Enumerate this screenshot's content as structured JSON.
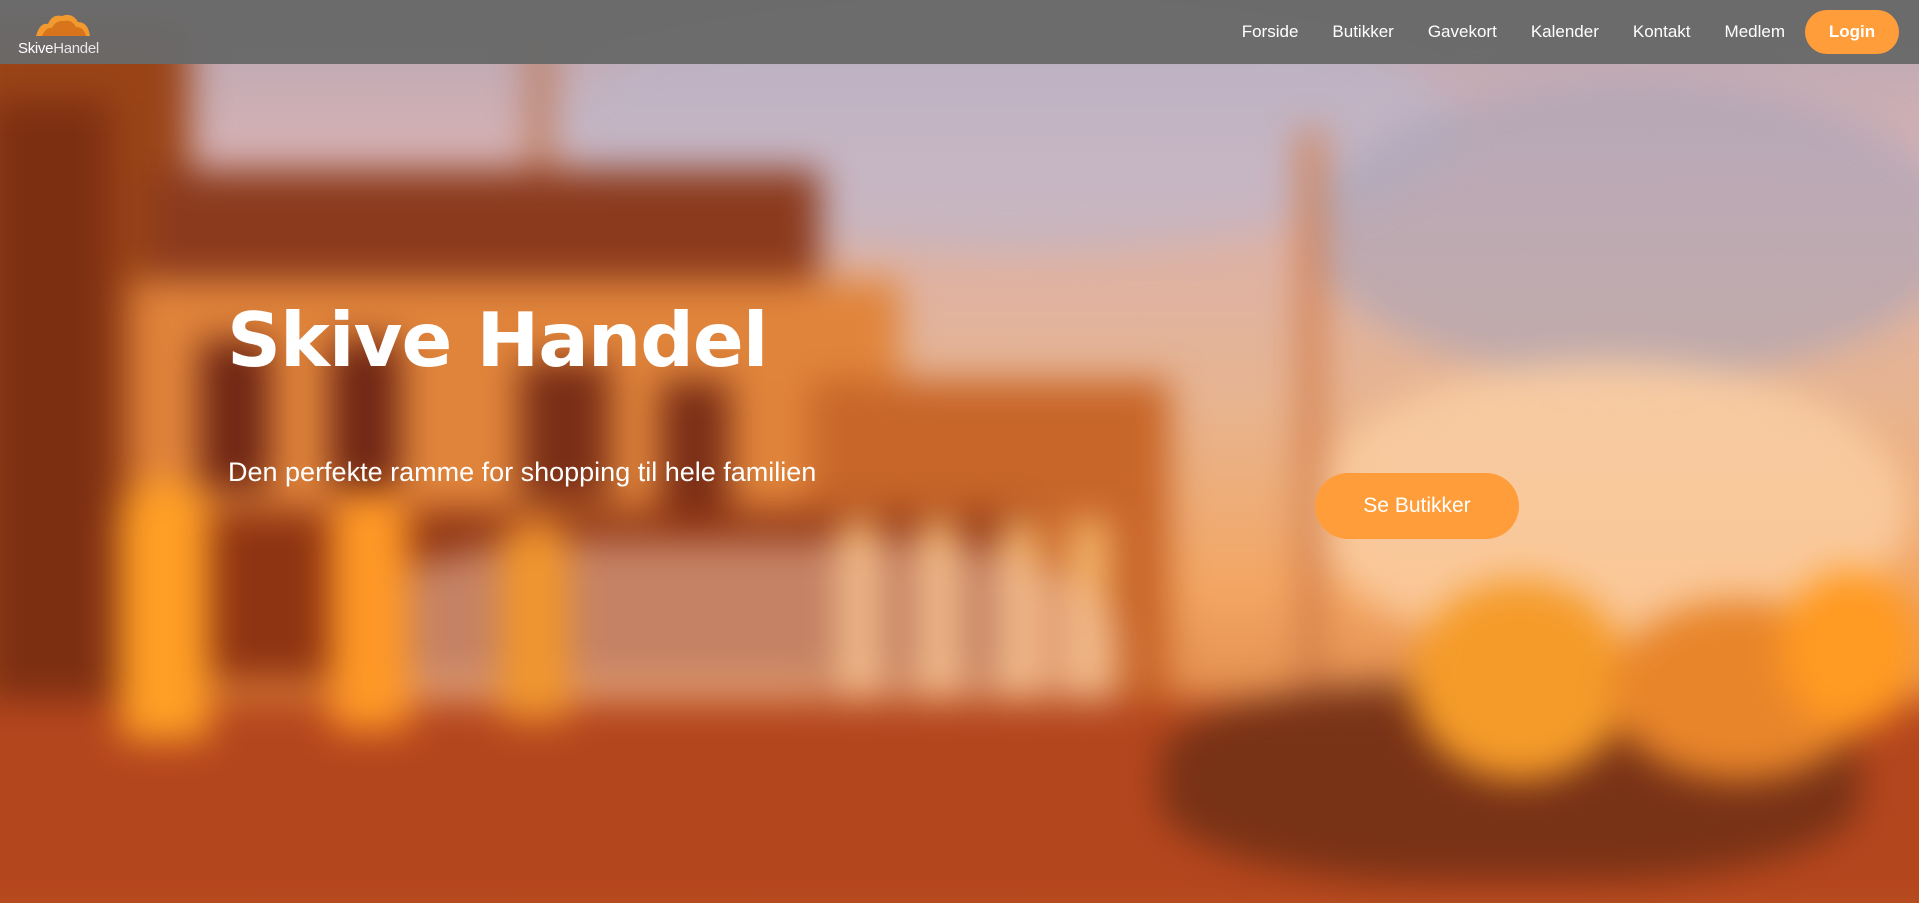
{
  "brand": {
    "logo_text_bold": "Skive",
    "logo_text_light": "Handel",
    "accent_color": "#ff9d3a"
  },
  "nav": {
    "items": [
      {
        "label": "Forside"
      },
      {
        "label": "Butikker"
      },
      {
        "label": "Gavekort"
      },
      {
        "label": "Kalender"
      },
      {
        "label": "Kontakt"
      },
      {
        "label": "Medlem"
      }
    ],
    "login_label": "Login"
  },
  "hero": {
    "title": "Skive Handel",
    "subtitle": "Den perfekte ramme for shopping til hele familien",
    "cta_label": "Se Butikker"
  }
}
